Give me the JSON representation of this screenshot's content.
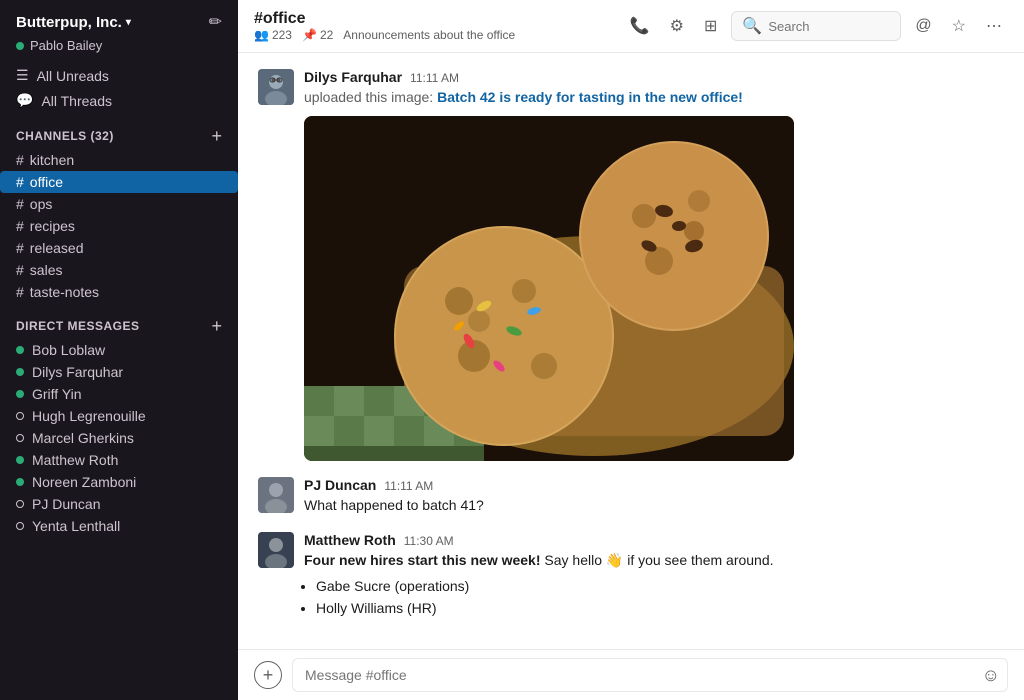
{
  "sidebar": {
    "workspace": "Butterpup, Inc.",
    "workspace_chevron": "▾",
    "user": "Pablo Bailey",
    "user_status": "online",
    "nav": [
      {
        "label": "All Unreads",
        "icon": "☰"
      },
      {
        "label": "All Threads",
        "icon": "💬"
      }
    ],
    "channels_section": "CHANNELS",
    "channels_count": "32",
    "channels": [
      {
        "name": "kitchen",
        "active": false
      },
      {
        "name": "office",
        "active": true
      },
      {
        "name": "ops",
        "active": false
      },
      {
        "name": "recipes",
        "active": false
      },
      {
        "name": "released",
        "active": false
      },
      {
        "name": "sales",
        "active": false
      },
      {
        "name": "taste-notes",
        "active": false
      }
    ],
    "dm_section": "DIRECT MESSAGES",
    "dms": [
      {
        "name": "Bob Loblaw",
        "status": "online"
      },
      {
        "name": "Dilys Farquhar",
        "status": "online"
      },
      {
        "name": "Griff Yin",
        "status": "online"
      },
      {
        "name": "Hugh Legrenouille",
        "status": "offline"
      },
      {
        "name": "Marcel Gherkins",
        "status": "offline"
      },
      {
        "name": "Matthew Roth",
        "status": "online"
      },
      {
        "name": "Noreen Zamboni",
        "status": "online"
      },
      {
        "name": "PJ Duncan",
        "status": "offline"
      },
      {
        "name": "Yenta Lenthall",
        "status": "offline"
      }
    ]
  },
  "header": {
    "channel_name": "#office",
    "members": "223",
    "pinned": "22",
    "description": "Announcements about the office",
    "search_placeholder": "Search"
  },
  "messages": [
    {
      "id": "msg1",
      "author": "Dilys Farquhar",
      "time": "11:11 AM",
      "upload_text": "uploaded this image:",
      "link_text": "Batch 42 is ready for tasting in the new office!",
      "has_image": true
    },
    {
      "id": "msg2",
      "author": "PJ Duncan",
      "time": "11:11 AM",
      "text": "What happened to batch 41?"
    },
    {
      "id": "msg3",
      "author": "Matthew Roth",
      "time": "11:30 AM",
      "bold_text": "Four new hires start this new week!",
      "text_after": " Say hello 👋 if you see them around.",
      "bullets": [
        "Gabe Sucre (operations)",
        "Holly Williams (HR)"
      ]
    }
  ],
  "input": {
    "placeholder": "Message #office"
  }
}
